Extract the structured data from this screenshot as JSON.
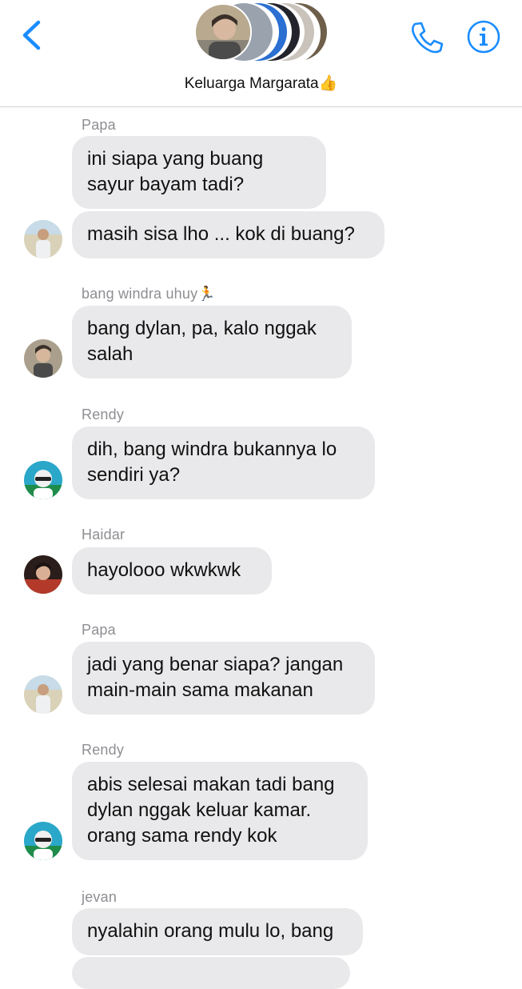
{
  "header": {
    "title": "Keluarga Margarata",
    "title_emoji": "👍",
    "icons": {
      "back": "chevron-left-icon",
      "call": "phone-icon",
      "info": "info-icon"
    },
    "accent_color": "#1a8cff"
  },
  "messages": [
    {
      "sender": "Papa",
      "texts": [
        "ini siapa yang buang sayur bayam tadi?",
        "masih sisa lho ... kok di buang?"
      ]
    },
    {
      "sender": "bang windra uhuy🏃",
      "texts": [
        "bang dylan, pa, kalo nggak salah"
      ]
    },
    {
      "sender": "Rendy",
      "texts": [
        "dih, bang windra bukannya lo sendiri ya?"
      ]
    },
    {
      "sender": "Haidar",
      "texts": [
        "hayolooo wkwkwk"
      ]
    },
    {
      "sender": "Papa",
      "texts": [
        "jadi yang benar siapa? jangan main-main sama makanan"
      ]
    },
    {
      "sender": "Rendy",
      "texts": [
        "abis selesai makan tadi bang dylan nggak keluar kamar. orang sama rendy kok"
      ]
    },
    {
      "sender": "jevan",
      "texts": [
        "nyalahin orang mulu lo, bang"
      ]
    }
  ],
  "colors": {
    "bubble": "#e9e9eb",
    "sender_name": "#8e8e93",
    "divider": "#d1d1d6"
  }
}
